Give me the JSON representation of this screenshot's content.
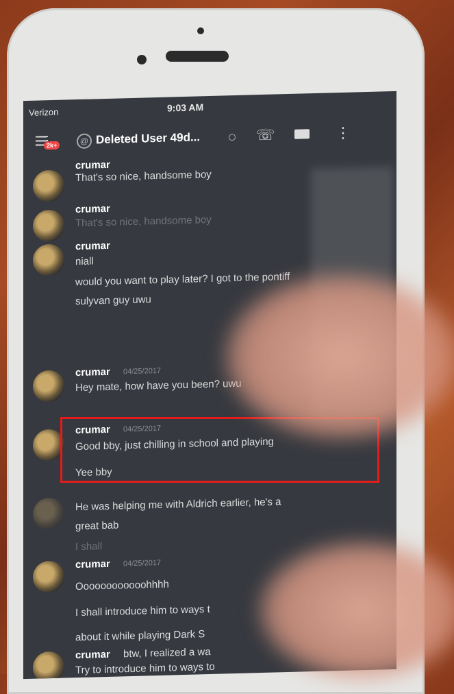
{
  "status_bar": {
    "carrier": "Verizon",
    "time": "9:03 AM"
  },
  "header": {
    "badge": "2k+",
    "title": "Deleted User 49d..."
  },
  "messages": [
    {
      "author": "crumar",
      "timestamp": "",
      "lines": [
        "That's so nice, handsome boy"
      ]
    },
    {
      "author": "crumar",
      "timestamp": "",
      "lines": [
        "That's so nice, handsome boy"
      ]
    },
    {
      "author": "crumar",
      "timestamp": "",
      "lines": [
        "niall",
        "would you want to play later? I got to the pontiff",
        "sulyvan guy uwu"
      ]
    },
    {
      "author": "crumar",
      "timestamp": "04/25/2017",
      "lines": [
        "Hey mate, how have you been? uwu"
      ]
    },
    {
      "author": "crumar",
      "timestamp": "04/25/2017",
      "lines": [
        "Good bby, just chilling in school and playing",
        "Yee bby"
      ]
    },
    {
      "author": "",
      "timestamp": "",
      "lines": [
        "He was helping me with Aldrich earlier, he's a",
        "great bab",
        "I shall"
      ]
    },
    {
      "author": "crumar",
      "timestamp": "04/25/2017",
      "lines": [
        "Oooooooooooohhhh",
        "I shall introduce him to ways t",
        "about it while playing Dark S"
      ]
    },
    {
      "author": "crumar",
      "timestamp": "",
      "lines": [
        "btw, I realized a wa",
        "Try to introduce him to ways to"
      ]
    }
  ]
}
